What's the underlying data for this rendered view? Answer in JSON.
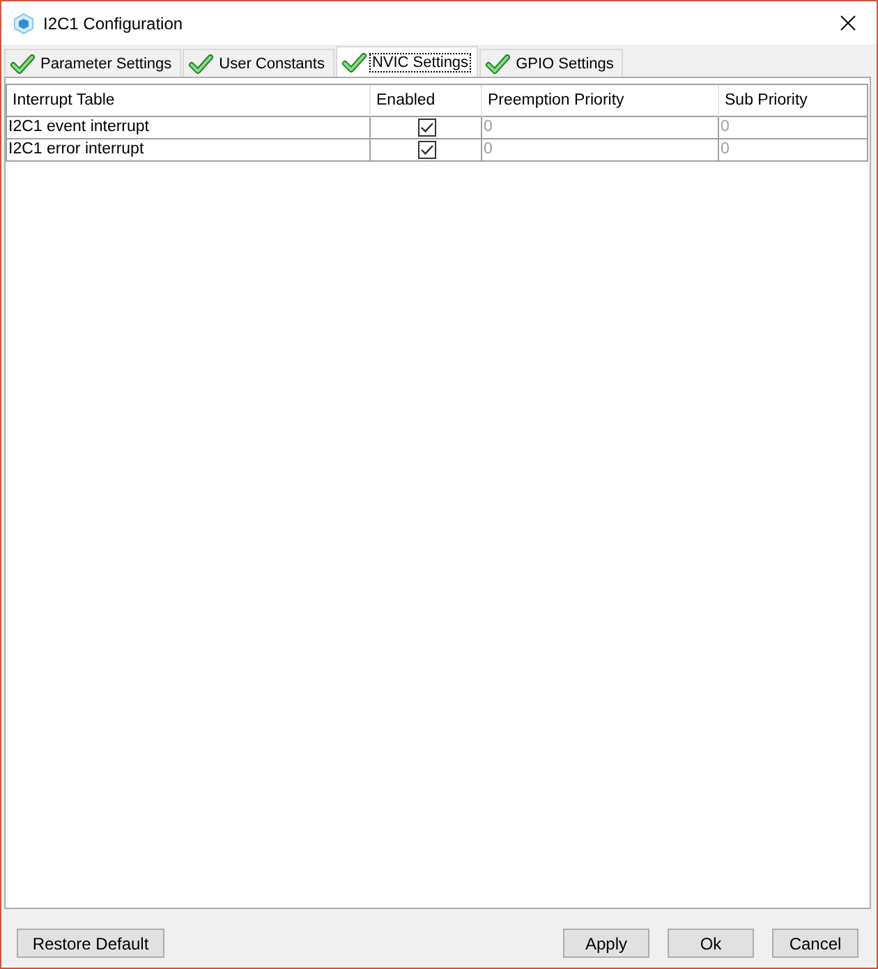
{
  "window": {
    "title": "I2C1 Configuration"
  },
  "tabs": [
    {
      "label": "Parameter Settings",
      "selected": false
    },
    {
      "label": "User Constants",
      "selected": false
    },
    {
      "label": "NVIC Settings",
      "selected": true
    },
    {
      "label": "GPIO Settings",
      "selected": false
    }
  ],
  "table": {
    "columns": [
      "Interrupt Table",
      "Enabled",
      "Preemption Priority",
      "Sub Priority"
    ],
    "rows": [
      {
        "name": "I2C1 event interrupt",
        "enabled": true,
        "preemption_priority": "0",
        "sub_priority": "0",
        "priorities_disabled": true
      },
      {
        "name": "I2C1 error interrupt",
        "enabled": true,
        "preemption_priority": "0",
        "sub_priority": "0",
        "priorities_disabled": true
      }
    ]
  },
  "footer": {
    "left_buttons": [
      "Restore Default"
    ],
    "right_buttons": [
      "Apply",
      "Ok",
      "Cancel"
    ]
  }
}
